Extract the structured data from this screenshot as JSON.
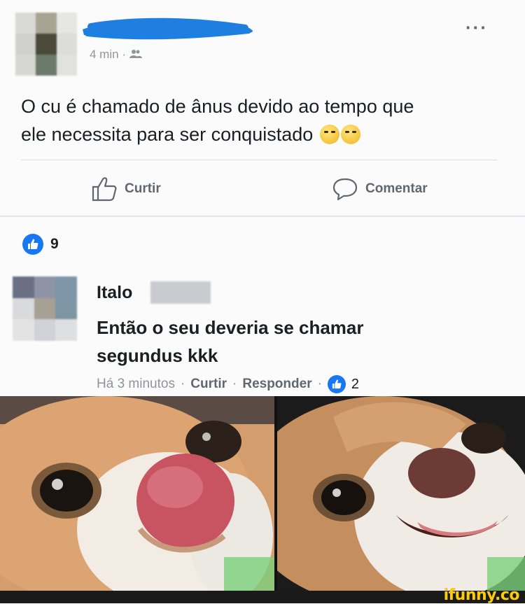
{
  "post": {
    "time": "4 min",
    "separator": "·",
    "audience_icon": "friends-icon",
    "text_line1": "O cu é chamado de ânus devido ao tempo que",
    "text_line2": "ele necessita para ser conquistado",
    "more_label": "···"
  },
  "actions": {
    "like_label": "Curtir",
    "comment_label": "Comentar"
  },
  "reactions": {
    "count": "9"
  },
  "comment": {
    "author": "Italo",
    "text_line1": "Então o seu deveria se chamar",
    "text_line2": "segundus kkk",
    "time": "Há 3 minutos",
    "like_label": "Curtir",
    "reply_label": "Responder",
    "sep": "·",
    "reaction_count": "2"
  },
  "watermark": "ifunny.co",
  "colors": {
    "accent": "#1877f2",
    "scribble": "#1f7fe0",
    "watermark": "#ffcc00"
  }
}
